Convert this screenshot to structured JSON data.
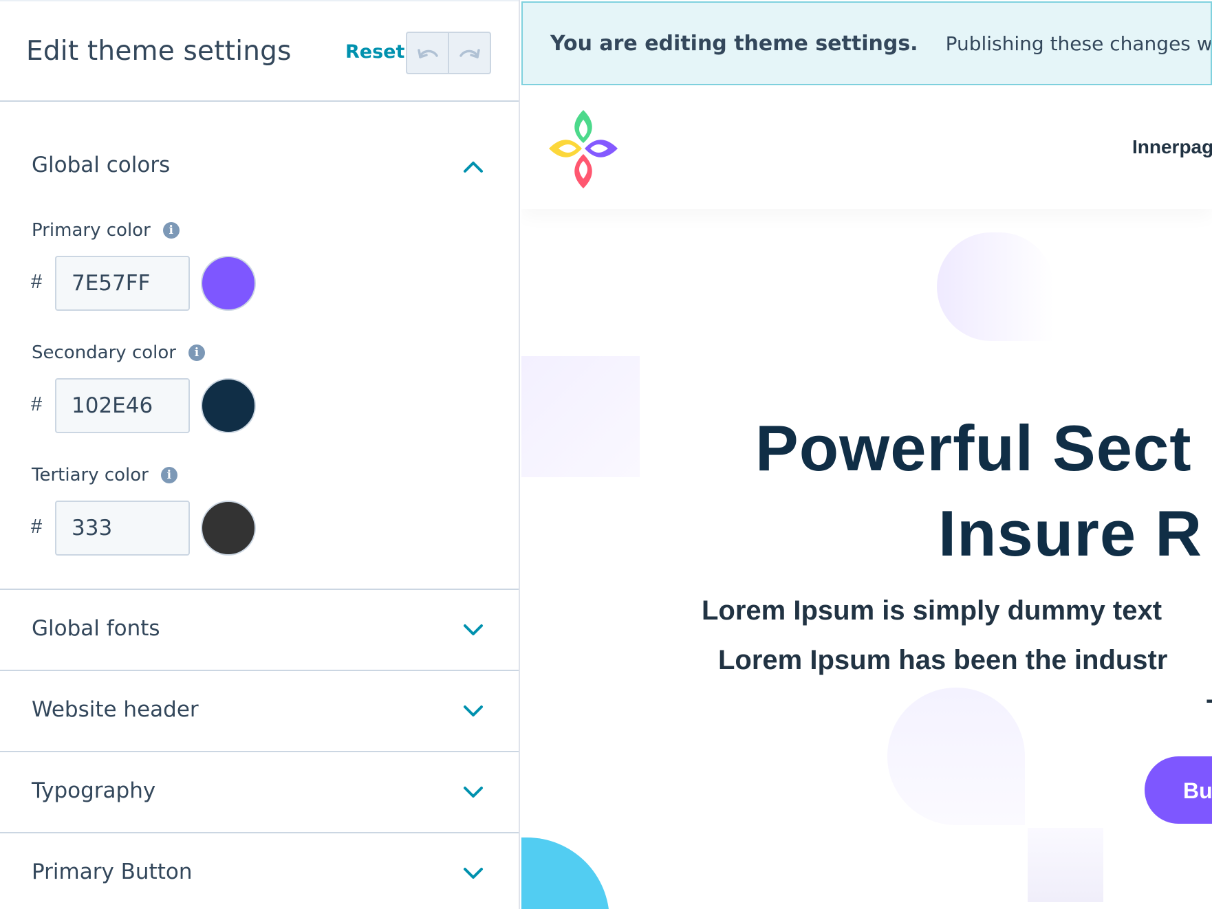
{
  "panel": {
    "title": "Edit theme settings",
    "reset_label": "Reset",
    "undo_icon": "undo-icon",
    "redo_icon": "redo-icon"
  },
  "global_colors": {
    "title": "Global colors",
    "expanded": true,
    "primary": {
      "label": "Primary color",
      "hash": "#",
      "value": "7E57FF",
      "swatch": "#7E57FF"
    },
    "secondary": {
      "label": "Secondary color",
      "hash": "#",
      "value": "102E46",
      "swatch": "#102E46"
    },
    "tertiary": {
      "label": "Tertiary color",
      "hash": "#",
      "value": "333",
      "swatch": "#333333"
    }
  },
  "sections": [
    {
      "title": "Global fonts",
      "expanded": false
    },
    {
      "title": "Website header",
      "expanded": false
    },
    {
      "title": "Typography",
      "expanded": false
    },
    {
      "title": "Primary Button",
      "expanded": false
    }
  ],
  "banner": {
    "strong": "You are editing theme settings.",
    "text": "Publishing these changes will affect"
  },
  "preview": {
    "nav_item": "Innerpage",
    "hero_title_1": "Powerful Sect",
    "hero_title_2": "Insure R",
    "hero_sub_1": "Lorem Ipsum is simply dummy text",
    "hero_sub_2": "Lorem Ipsum has been the industr",
    "hero_sub_3": "T",
    "cta_label": "Bu"
  },
  "colors": {
    "accent": "#0091ae",
    "primary": "#7E57FF",
    "secondary": "#102E46",
    "banner_bg": "#e5f5f8"
  }
}
